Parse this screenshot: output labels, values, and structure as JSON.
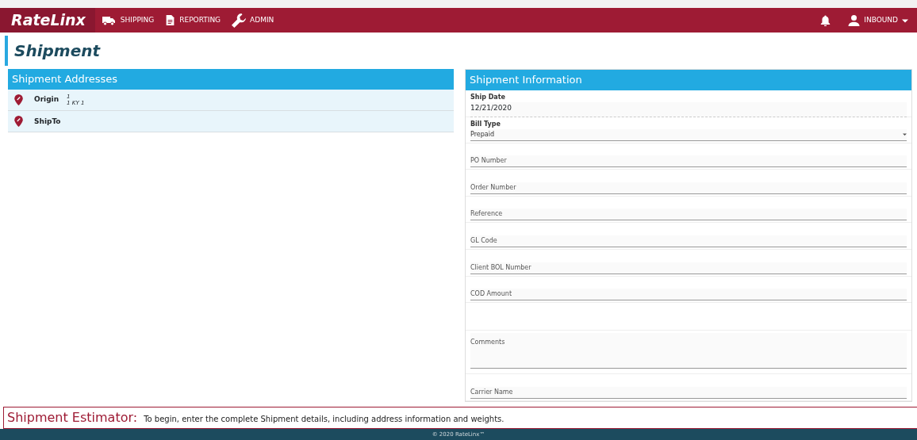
{
  "navbar": {
    "brand": "RateLinx",
    "items": [
      {
        "label": "SHIPPING",
        "kind": "truck"
      },
      {
        "label": "REPORTING",
        "kind": "document"
      },
      {
        "label": "ADMIN",
        "kind": "wrench"
      }
    ],
    "user": "INBOUND"
  },
  "page_title": "Shipment",
  "addresses": {
    "title": "Shipment Addresses",
    "items": [
      {
        "label": "Origin",
        "lines": [
          "1",
          "1 KY 1"
        ]
      },
      {
        "label": "ShipTo"
      }
    ]
  },
  "information": {
    "title": "Shipment Information",
    "fields": [
      {
        "kind": "static",
        "label": "Ship Date",
        "value": "12/21/2020"
      },
      {
        "kind": "select",
        "label": "Bill Type",
        "value": "Prepaid"
      },
      {
        "kind": "text",
        "placeholder": "PO Number"
      },
      {
        "kind": "text",
        "placeholder": "Order Number"
      },
      {
        "kind": "text",
        "placeholder": "Reference"
      },
      {
        "kind": "text",
        "placeholder": "GL Code"
      },
      {
        "kind": "text",
        "placeholder": "Client BOL Number"
      },
      {
        "kind": "text",
        "placeholder": "COD Amount"
      },
      {
        "kind": "spacer"
      },
      {
        "kind": "textarea",
        "placeholder": "Comments"
      },
      {
        "kind": "text",
        "placeholder": "Carrier Name"
      }
    ]
  },
  "estimator": {
    "title": "Shipment Estimator:",
    "message": "To begin, enter the complete Shipment details, including address information and weights."
  },
  "footer": "© 2020 RateLinx™"
}
